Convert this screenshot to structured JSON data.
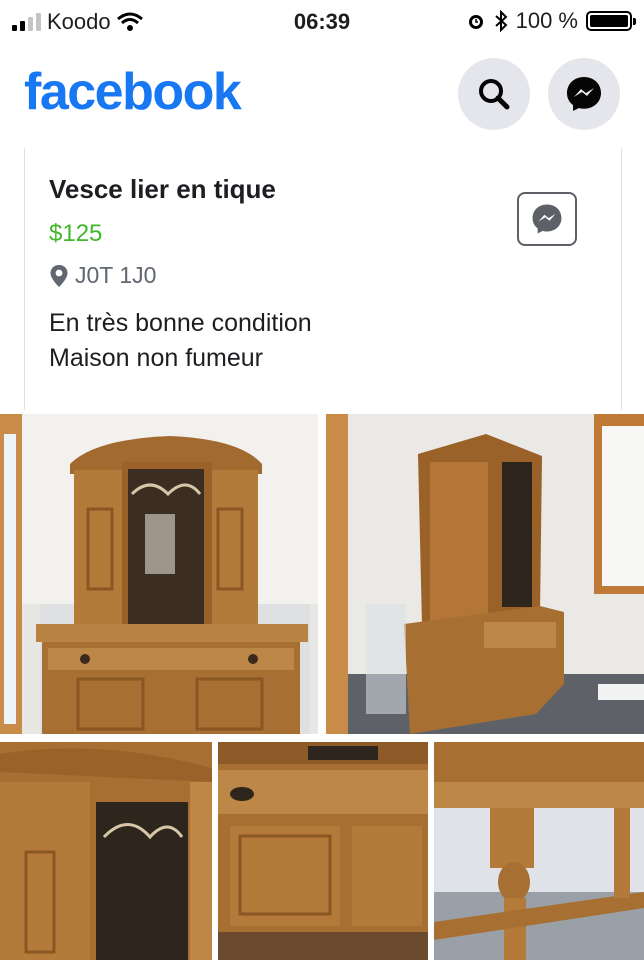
{
  "status_bar": {
    "carrier": "Koodo",
    "time": "06:39",
    "battery": "100 %"
  },
  "header": {
    "logo": "facebook",
    "icons": [
      "search-icon",
      "messenger-icon"
    ]
  },
  "listing": {
    "title": "Vesce lier en tique",
    "price": "$125",
    "location": "J0T 1J0",
    "description_lines": [
      "En très bonne condition",
      "Maison non fumeur"
    ]
  },
  "colors": {
    "brand": "#1877f2",
    "price": "#42b72a"
  },
  "photos": [
    "hutch-front-photo",
    "hutch-side-photo",
    "cabinet-door-closeup-photo",
    "buffet-doors-closeup-photo",
    "legs-closeup-photo"
  ]
}
